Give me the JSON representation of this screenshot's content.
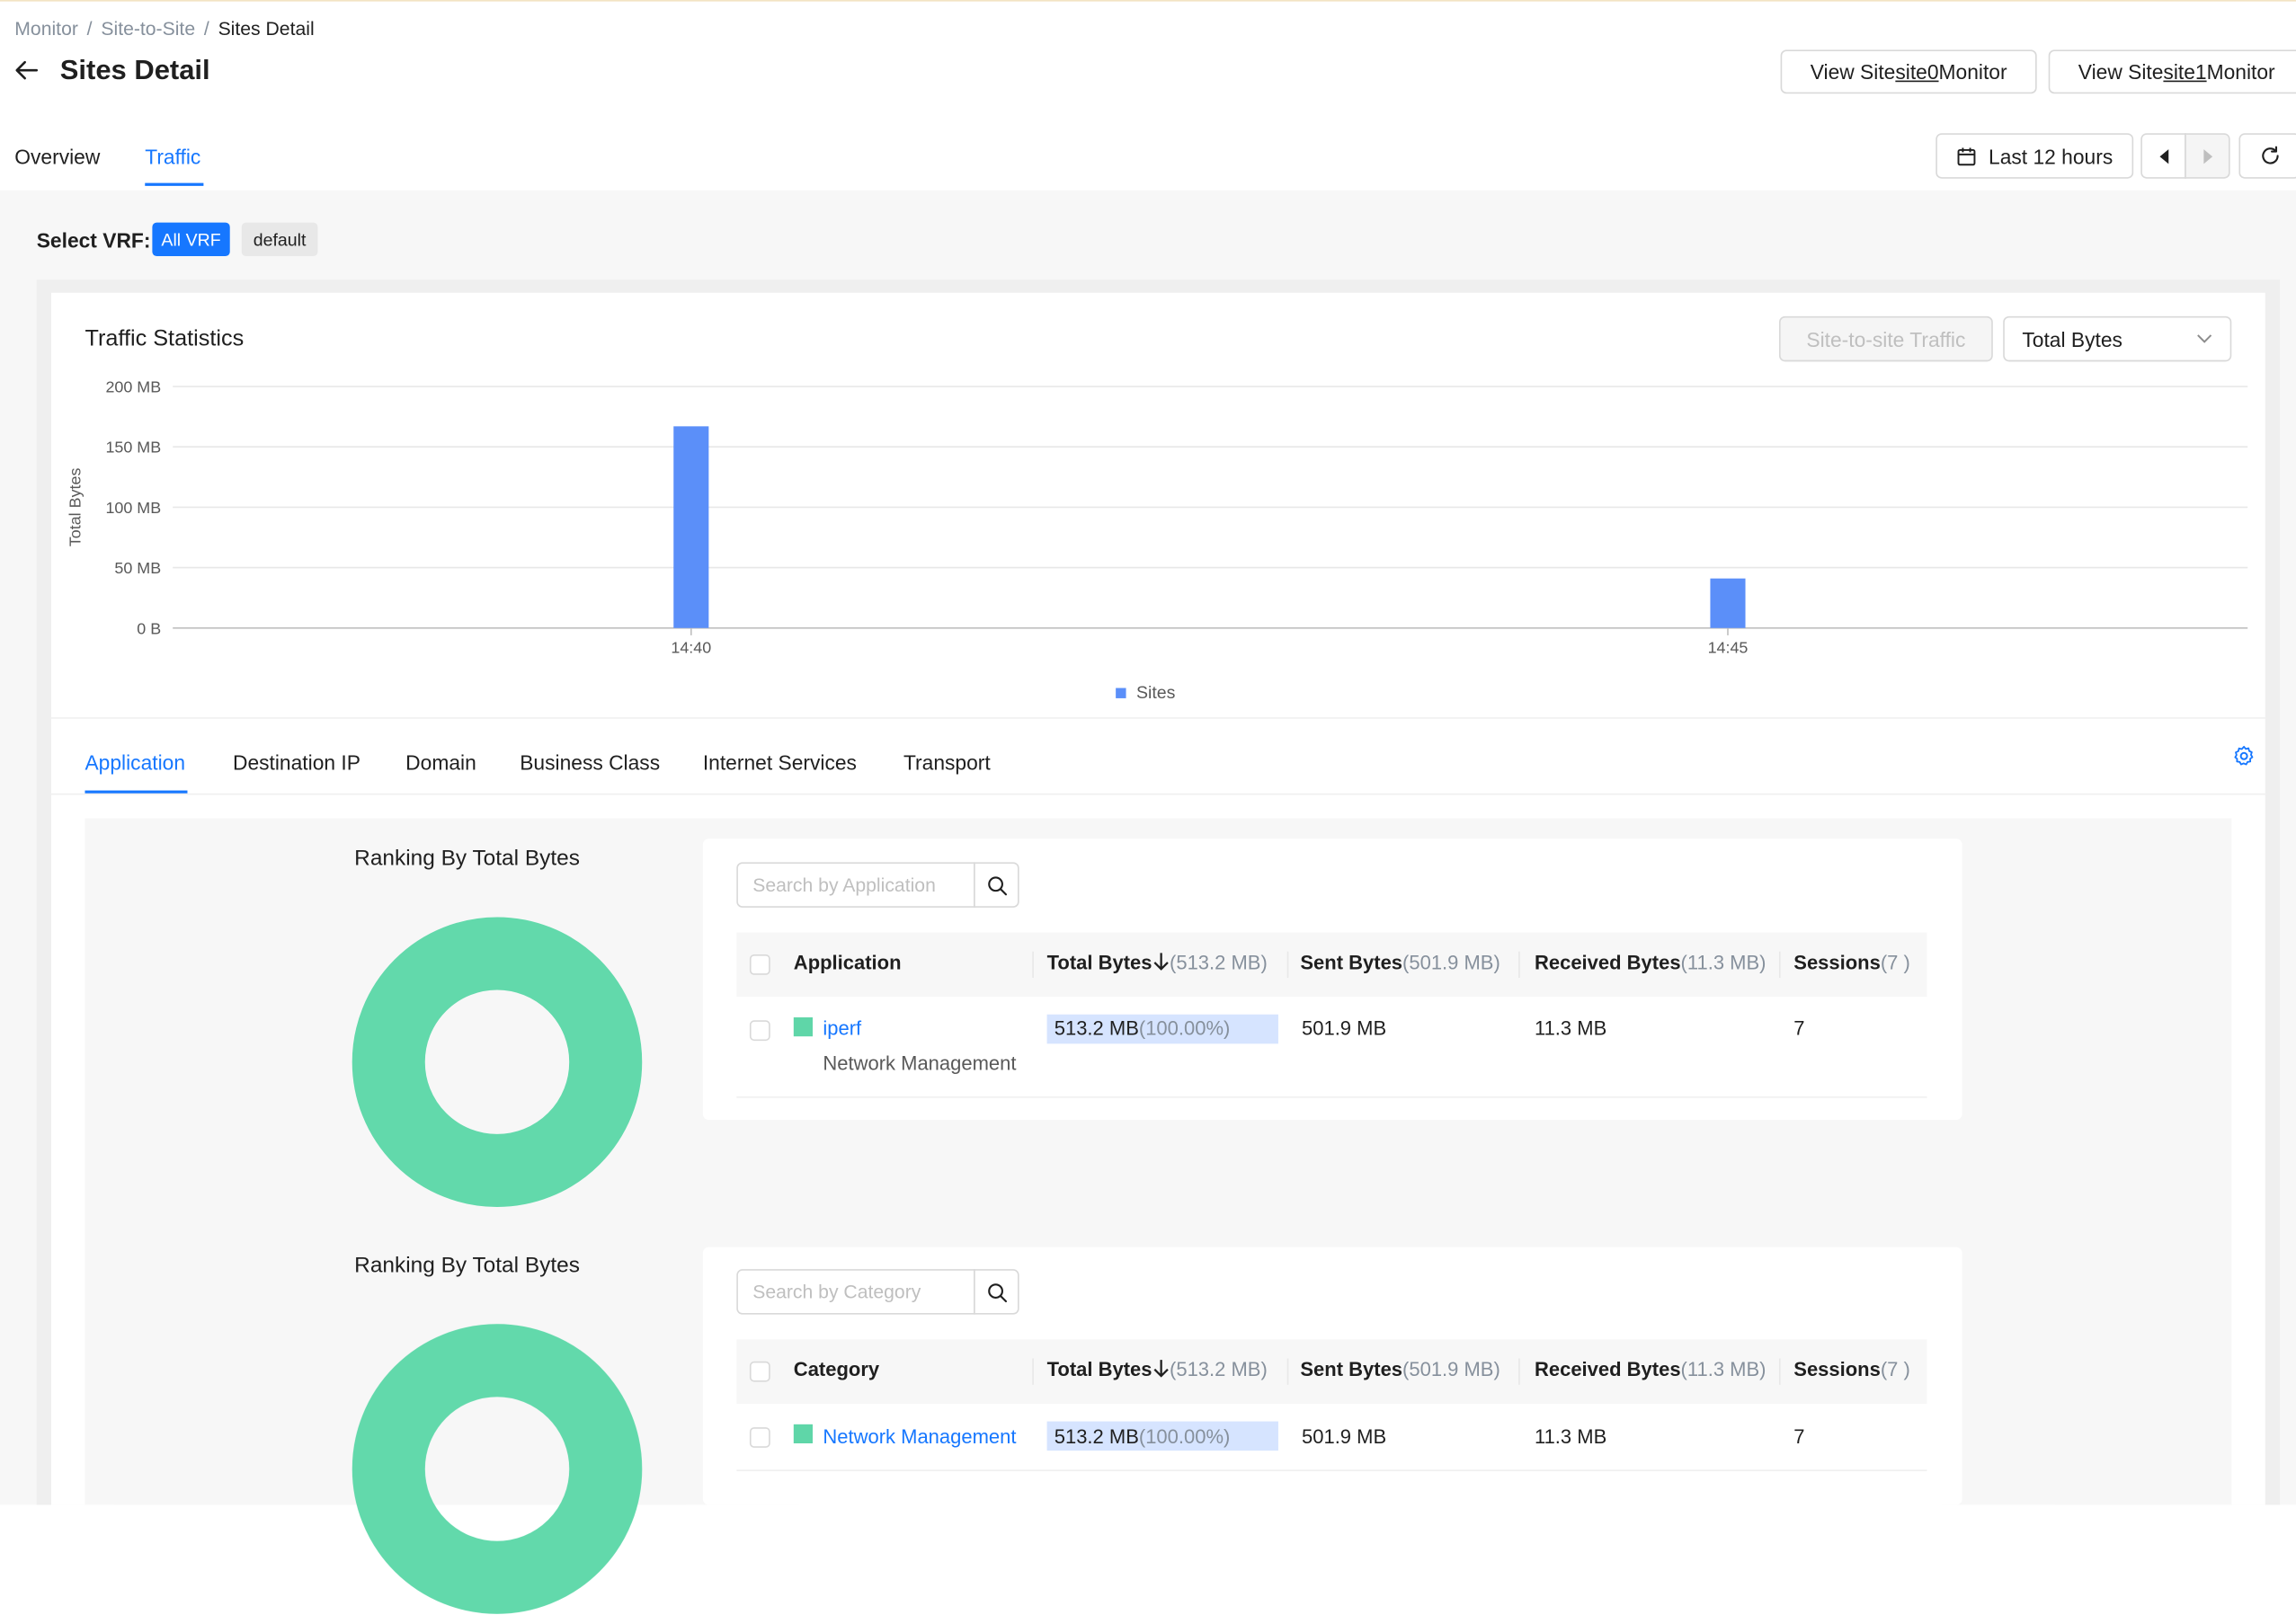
{
  "breadcrumb": [
    "Monitor",
    "Site-to-Site",
    "Sites Detail"
  ],
  "page_title": "Sites Detail",
  "site_buttons": [
    {
      "prefix": "View Site ",
      "site": "site0",
      "suffix": " Monitor"
    },
    {
      "prefix": "View Site ",
      "site": "site1",
      "suffix": " Monitor"
    }
  ],
  "page_tabs": [
    {
      "label": "Overview",
      "active": false
    },
    {
      "label": "Traffic",
      "active": true
    }
  ],
  "time_range": "Last 12 hours",
  "vrf": {
    "label": "Select VRF:",
    "options": [
      "All VRF",
      "default"
    ],
    "selected": "All VRF"
  },
  "traffic": {
    "title": "Traffic Statistics",
    "type_button": "Site-to-site Traffic",
    "metric_select": "Total Bytes"
  },
  "chart_data": {
    "type": "bar",
    "ylabel": "Total Bytes",
    "yticks": [
      "0 B",
      "50 MB",
      "100 MB",
      "150 MB",
      "200 MB"
    ],
    "ylim": [
      0,
      200
    ],
    "xticks": [
      "14:40",
      "14:45"
    ],
    "series": [
      {
        "name": "Sites",
        "color": "#5b8ff9",
        "points": [
          {
            "x": "14:40",
            "y": 167
          },
          {
            "x": "14:45",
            "y": 41
          }
        ]
      }
    ],
    "legend": "bottom"
  },
  "sub_tabs": [
    "Application",
    "Destination IP",
    "Domain",
    "Business Class",
    "Internet Services",
    "Transport"
  ],
  "active_sub_tab": "Application",
  "colors": {
    "accent": "#1677ff",
    "bar": "#5b8ff9",
    "donut": "#62d9ab"
  },
  "sections": [
    {
      "rank_title": "Ranking By Total Bytes",
      "search_placeholder": "Search by Application",
      "columns": {
        "name": "Application",
        "total": "Total Bytes",
        "total_sum": "(513.2 MB)",
        "sent": "Sent Bytes",
        "sent_sum": "(501.9 MB)",
        "received": "Received Bytes",
        "received_sum": "(11.3 MB)",
        "sessions": "Sessions",
        "sessions_sum": "(7 )"
      },
      "rows": [
        {
          "name": "iperf",
          "subtitle": "Network Management",
          "total": "513.2 MB",
          "pct": "(100.00%)",
          "sent": "501.9 MB",
          "received": "11.3 MB",
          "sessions": "7"
        }
      ]
    },
    {
      "rank_title": "Ranking By Total Bytes",
      "search_placeholder": "Search by Category",
      "columns": {
        "name": "Category",
        "total": "Total Bytes",
        "total_sum": "(513.2 MB)",
        "sent": "Sent Bytes",
        "sent_sum": "(501.9 MB)",
        "received": "Received Bytes",
        "received_sum": "(11.3 MB)",
        "sessions": "Sessions",
        "sessions_sum": "(7 )"
      },
      "rows": [
        {
          "name": "Network Management",
          "total": "513.2 MB",
          "pct": "(100.00%)",
          "sent": "501.9 MB",
          "received": "11.3 MB",
          "sessions": "7"
        }
      ]
    }
  ]
}
